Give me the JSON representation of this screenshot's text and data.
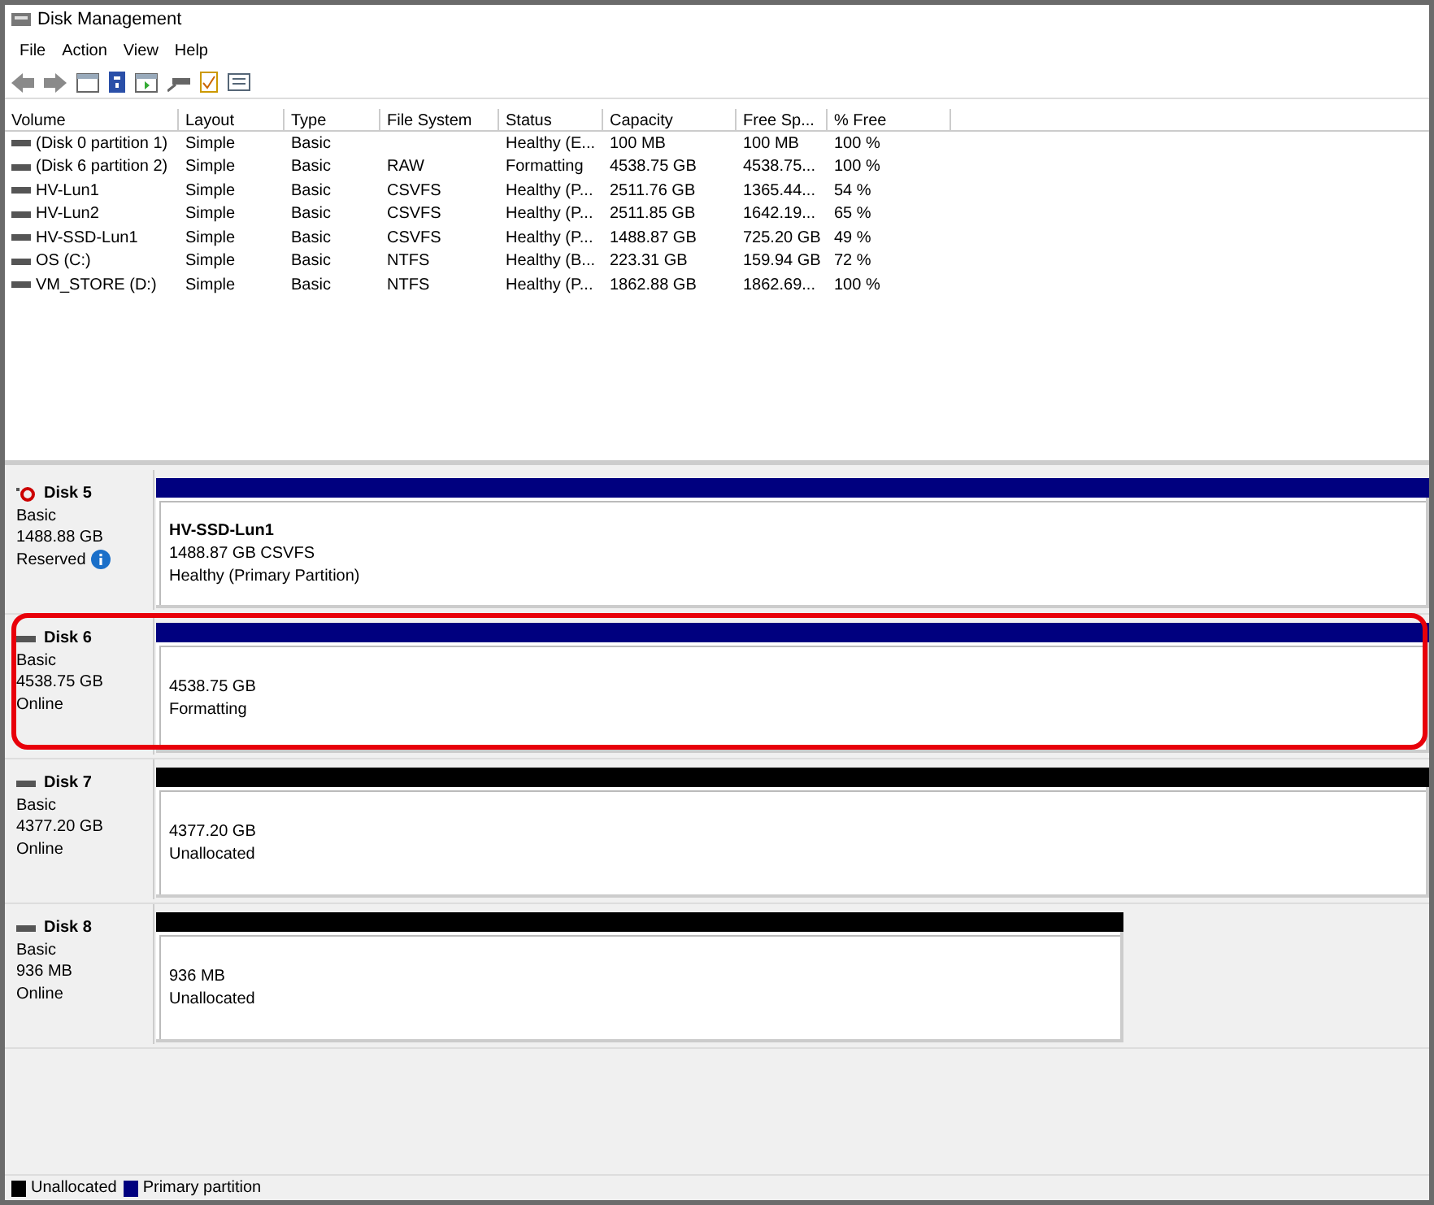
{
  "window": {
    "title": "Disk Management"
  },
  "menu": [
    "File",
    "Action",
    "View",
    "Help"
  ],
  "table": {
    "columns": [
      "Volume",
      "Layout",
      "Type",
      "File System",
      "Status",
      "Capacity",
      "Free Sp...",
      "% Free"
    ],
    "rows": [
      [
        "(Disk 0 partition 1)",
        "Simple",
        "Basic",
        "",
        "Healthy (E...",
        "100 MB",
        "100 MB",
        "100 %"
      ],
      [
        "(Disk 6 partition 2)",
        "Simple",
        "Basic",
        "RAW",
        "Formatting",
        "4538.75 GB",
        "4538.75...",
        "100 %"
      ],
      [
        "HV-Lun1",
        "Simple",
        "Basic",
        "CSVFS",
        "Healthy (P...",
        "2511.76 GB",
        "1365.44...",
        "54 %"
      ],
      [
        "HV-Lun2",
        "Simple",
        "Basic",
        "CSVFS",
        "Healthy (P...",
        "2511.85 GB",
        "1642.19...",
        "65 %"
      ],
      [
        "HV-SSD-Lun1",
        "Simple",
        "Basic",
        "CSVFS",
        "Healthy (P...",
        "1488.87 GB",
        "725.20 GB",
        "49 %"
      ],
      [
        "OS (C:)",
        "Simple",
        "Basic",
        "NTFS",
        "Healthy (B...",
        "223.31 GB",
        "159.94 GB",
        "72 %"
      ],
      [
        "VM_STORE (D:)",
        "Simple",
        "Basic",
        "NTFS",
        "Healthy (P...",
        "1862.88 GB",
        "1862.69...",
        "100 %"
      ]
    ]
  },
  "disks": [
    {
      "name": "Disk 5",
      "type": "Basic",
      "size": "1488.88 GB",
      "status": "Reserved",
      "warning": true,
      "highlighted": false,
      "narrow": false,
      "partition": {
        "name": "HV-SSD-Lun1",
        "lines": [
          "1488.87 GB CSVFS",
          "Healthy (Primary Partition)"
        ],
        "color": "#00007f"
      }
    },
    {
      "name": "Disk 6",
      "type": "Basic",
      "size": "4538.75 GB",
      "status": "Online",
      "warning": false,
      "highlighted": true,
      "narrow": false,
      "partition": {
        "lines": [
          "4538.75 GB",
          "Formatting"
        ],
        "color": "#00007f"
      }
    },
    {
      "name": "Disk 7",
      "type": "Basic",
      "size": "4377.20 GB",
      "status": "Online",
      "warning": false,
      "highlighted": false,
      "narrow": false,
      "partition": {
        "lines": [
          "4377.20 GB",
          "Unallocated"
        ],
        "color": "#000000"
      }
    },
    {
      "name": "Disk 8",
      "type": "Basic",
      "size": "936 MB",
      "status": "Online",
      "warning": false,
      "highlighted": false,
      "narrow": true,
      "partition": {
        "lines": [
          "936 MB",
          "Unallocated"
        ],
        "color": "#000000"
      }
    }
  ],
  "legend": [
    {
      "label": "Unallocated",
      "color": "#000000"
    },
    {
      "label": "Primary partition",
      "color": "#00007f"
    }
  ]
}
